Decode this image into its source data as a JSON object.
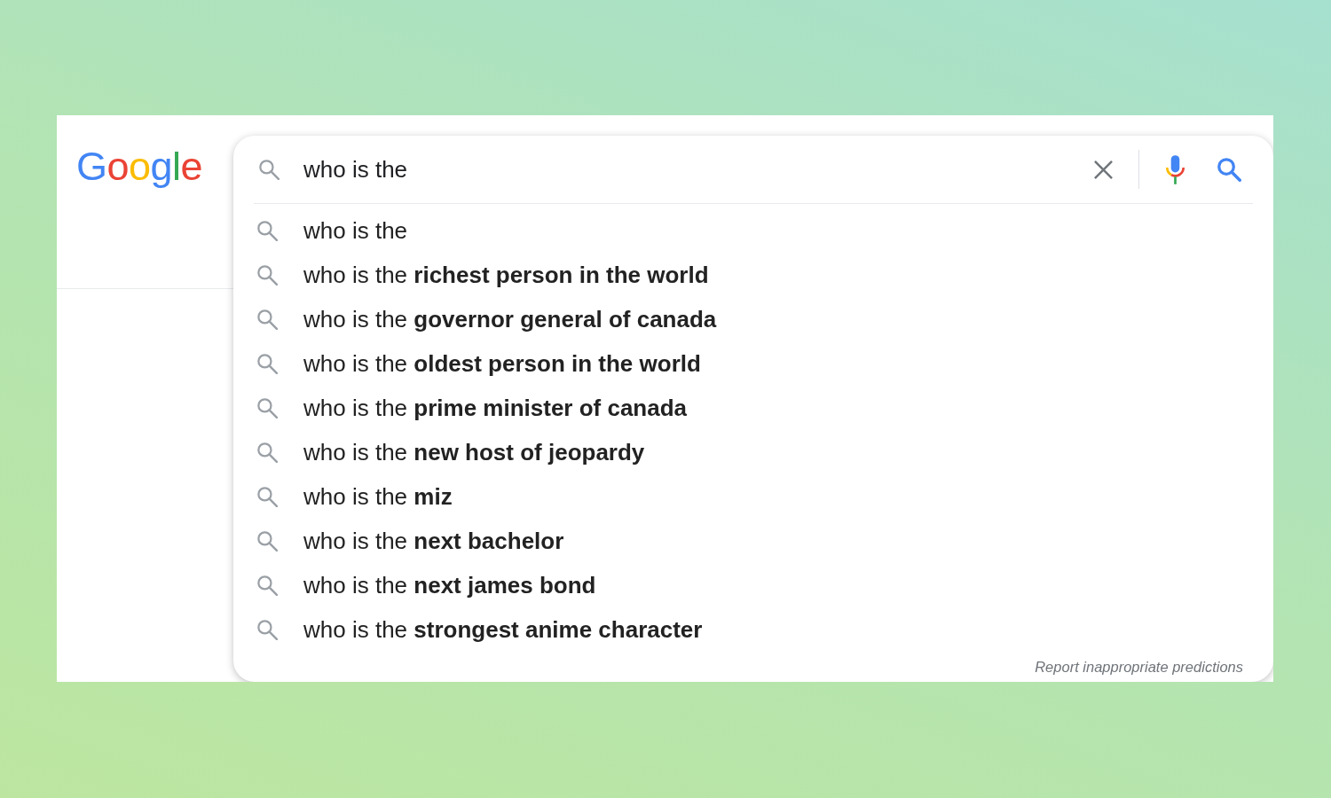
{
  "logo": "Google",
  "search": {
    "value": "who is the"
  },
  "suggestions": [
    "who is the",
    "who is the **richest person in the world**",
    "who is the **governor general of canada**",
    "who is the **oldest person in the world**",
    "who is the **prime minister of canada**",
    "who is the **new host of jeopardy**",
    "who is the **miz**",
    "who is the **next bachelor**",
    "who is the **next james bond**",
    "who is the **strongest anime character**"
  ],
  "report_link": "Report inappropriate predictions"
}
